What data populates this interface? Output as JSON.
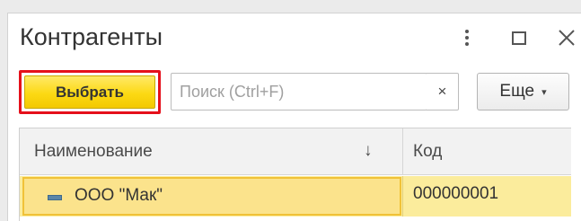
{
  "window": {
    "title": "Контрагенты",
    "controls": {
      "more": "more-vertical-icon",
      "maximize": "maximize-icon",
      "close": "close-icon"
    }
  },
  "toolbar": {
    "select_label": "Выбрать",
    "search": {
      "placeholder": "Поиск (Ctrl+F)",
      "value": ""
    },
    "clear_label": "×",
    "more_label": "Еще",
    "more_caret": "▾"
  },
  "table": {
    "columns": [
      {
        "label": "Наименование"
      },
      {
        "label": "Код"
      }
    ],
    "sort_indicator": "↓",
    "rows": [
      {
        "name": "ООО \"Мак\"",
        "code": "000000001",
        "icon": "item-icon"
      }
    ]
  },
  "colors": {
    "accent": "#fcd914",
    "focus_outline": "#e5101b",
    "selected_row": "#fbec9c"
  }
}
